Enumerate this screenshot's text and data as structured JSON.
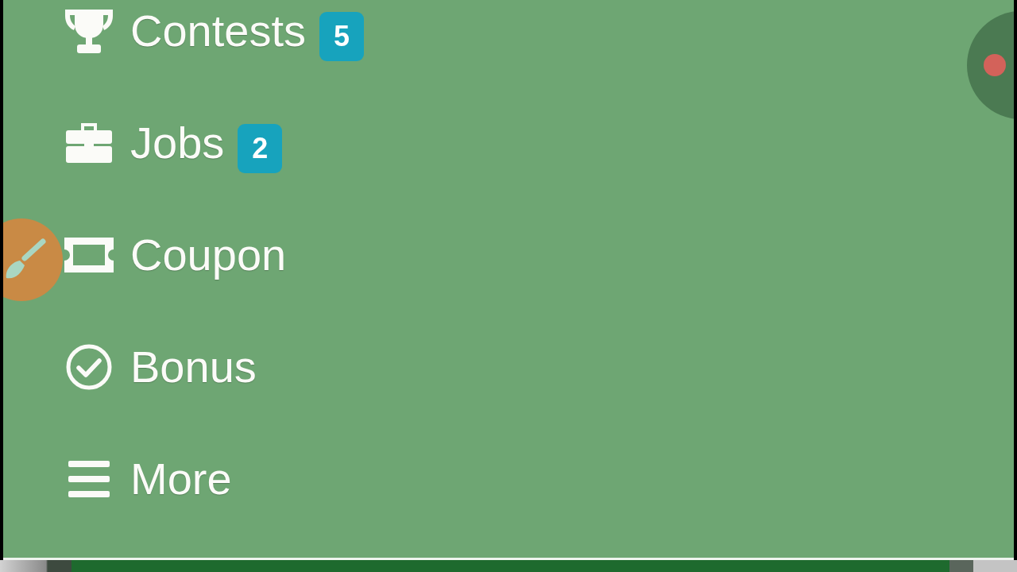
{
  "menu": {
    "items": [
      {
        "label": "Contests",
        "badge": "5"
      },
      {
        "label": "Jobs",
        "badge": "2"
      },
      {
        "label": "Coupon"
      },
      {
        "label": "Bonus"
      },
      {
        "label": "More"
      }
    ]
  }
}
